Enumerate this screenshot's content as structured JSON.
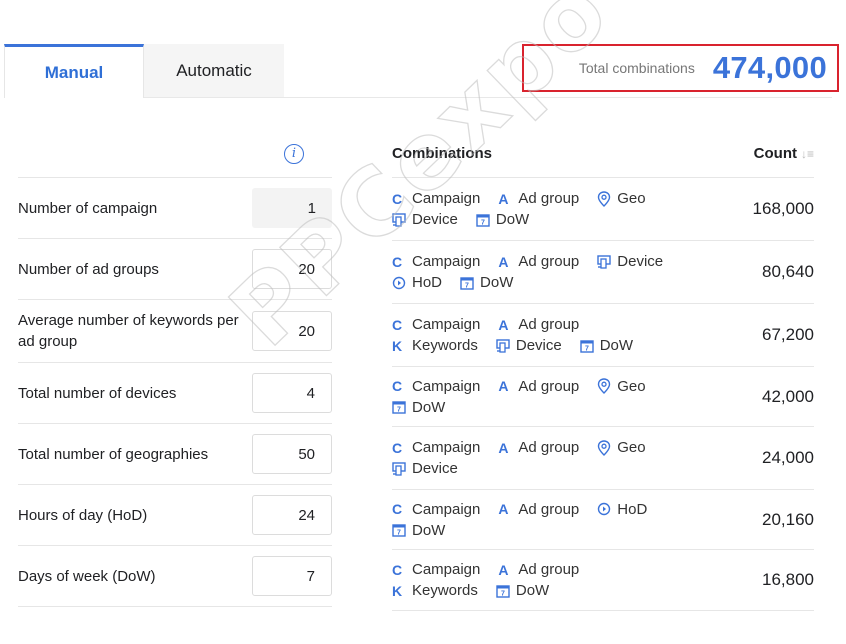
{
  "tabs": [
    {
      "label": "Manual",
      "active": true
    },
    {
      "label": "Automatic",
      "active": false
    }
  ],
  "total": {
    "label": "Total combinations",
    "value": "474,000",
    "highlight_color": "#d9232e",
    "value_color": "#3b73d9"
  },
  "inputs": [
    {
      "label": "Number of campaign",
      "value": "1",
      "editable": false
    },
    {
      "label": "Number of ad groups",
      "value": "20",
      "editable": true
    },
    {
      "label": "Average number of keywords per ad group",
      "value": "20",
      "editable": true
    },
    {
      "label": "Total number of devices",
      "value": "4",
      "editable": true
    },
    {
      "label": "Total number of geographies",
      "value": "50",
      "editable": true
    },
    {
      "label": "Hours of day (HoD)",
      "value": "24",
      "editable": true
    },
    {
      "label": "Days of week (DoW)",
      "value": "7",
      "editable": true
    }
  ],
  "combinations": {
    "header": "Combinations",
    "count_header": "Count",
    "rows": [
      {
        "chips": [
          {
            "icon": "C",
            "label": "Campaign"
          },
          {
            "icon": "A",
            "label": "Ad group"
          },
          {
            "icon": "geo",
            "label": "Geo"
          },
          {
            "icon": "device",
            "label": "Device"
          },
          {
            "icon": "dow",
            "label": "DoW"
          }
        ],
        "count": "168,000"
      },
      {
        "chips": [
          {
            "icon": "C",
            "label": "Campaign"
          },
          {
            "icon": "A",
            "label": "Ad group"
          },
          {
            "icon": "device",
            "label": "Device"
          },
          {
            "icon": "hod",
            "label": "HoD"
          },
          {
            "icon": "dow",
            "label": "DoW"
          }
        ],
        "count": "80,640"
      },
      {
        "chips": [
          {
            "icon": "C",
            "label": "Campaign"
          },
          {
            "icon": "A",
            "label": "Ad group"
          },
          {
            "icon": "K",
            "label": "Keywords"
          },
          {
            "icon": "device",
            "label": "Device"
          },
          {
            "icon": "dow",
            "label": "DoW"
          }
        ],
        "count": "67,200"
      },
      {
        "chips": [
          {
            "icon": "C",
            "label": "Campaign"
          },
          {
            "icon": "A",
            "label": "Ad group"
          },
          {
            "icon": "geo",
            "label": "Geo"
          },
          {
            "icon": "dow",
            "label": "DoW"
          }
        ],
        "count": "42,000"
      },
      {
        "chips": [
          {
            "icon": "C",
            "label": "Campaign"
          },
          {
            "icon": "A",
            "label": "Ad group"
          },
          {
            "icon": "geo",
            "label": "Geo"
          },
          {
            "icon": "device",
            "label": "Device"
          }
        ],
        "count": "24,000"
      },
      {
        "chips": [
          {
            "icon": "C",
            "label": "Campaign"
          },
          {
            "icon": "A",
            "label": "Ad group"
          },
          {
            "icon": "hod",
            "label": "HoD"
          },
          {
            "icon": "dow",
            "label": "DoW"
          }
        ],
        "count": "20,160"
      },
      {
        "chips": [
          {
            "icon": "C",
            "label": "Campaign"
          },
          {
            "icon": "A",
            "label": "Ad group"
          },
          {
            "icon": "K",
            "label": "Keywords"
          },
          {
            "icon": "dow",
            "label": "DoW"
          }
        ],
        "count": "16,800"
      }
    ]
  },
  "watermark": "PPCexpo"
}
